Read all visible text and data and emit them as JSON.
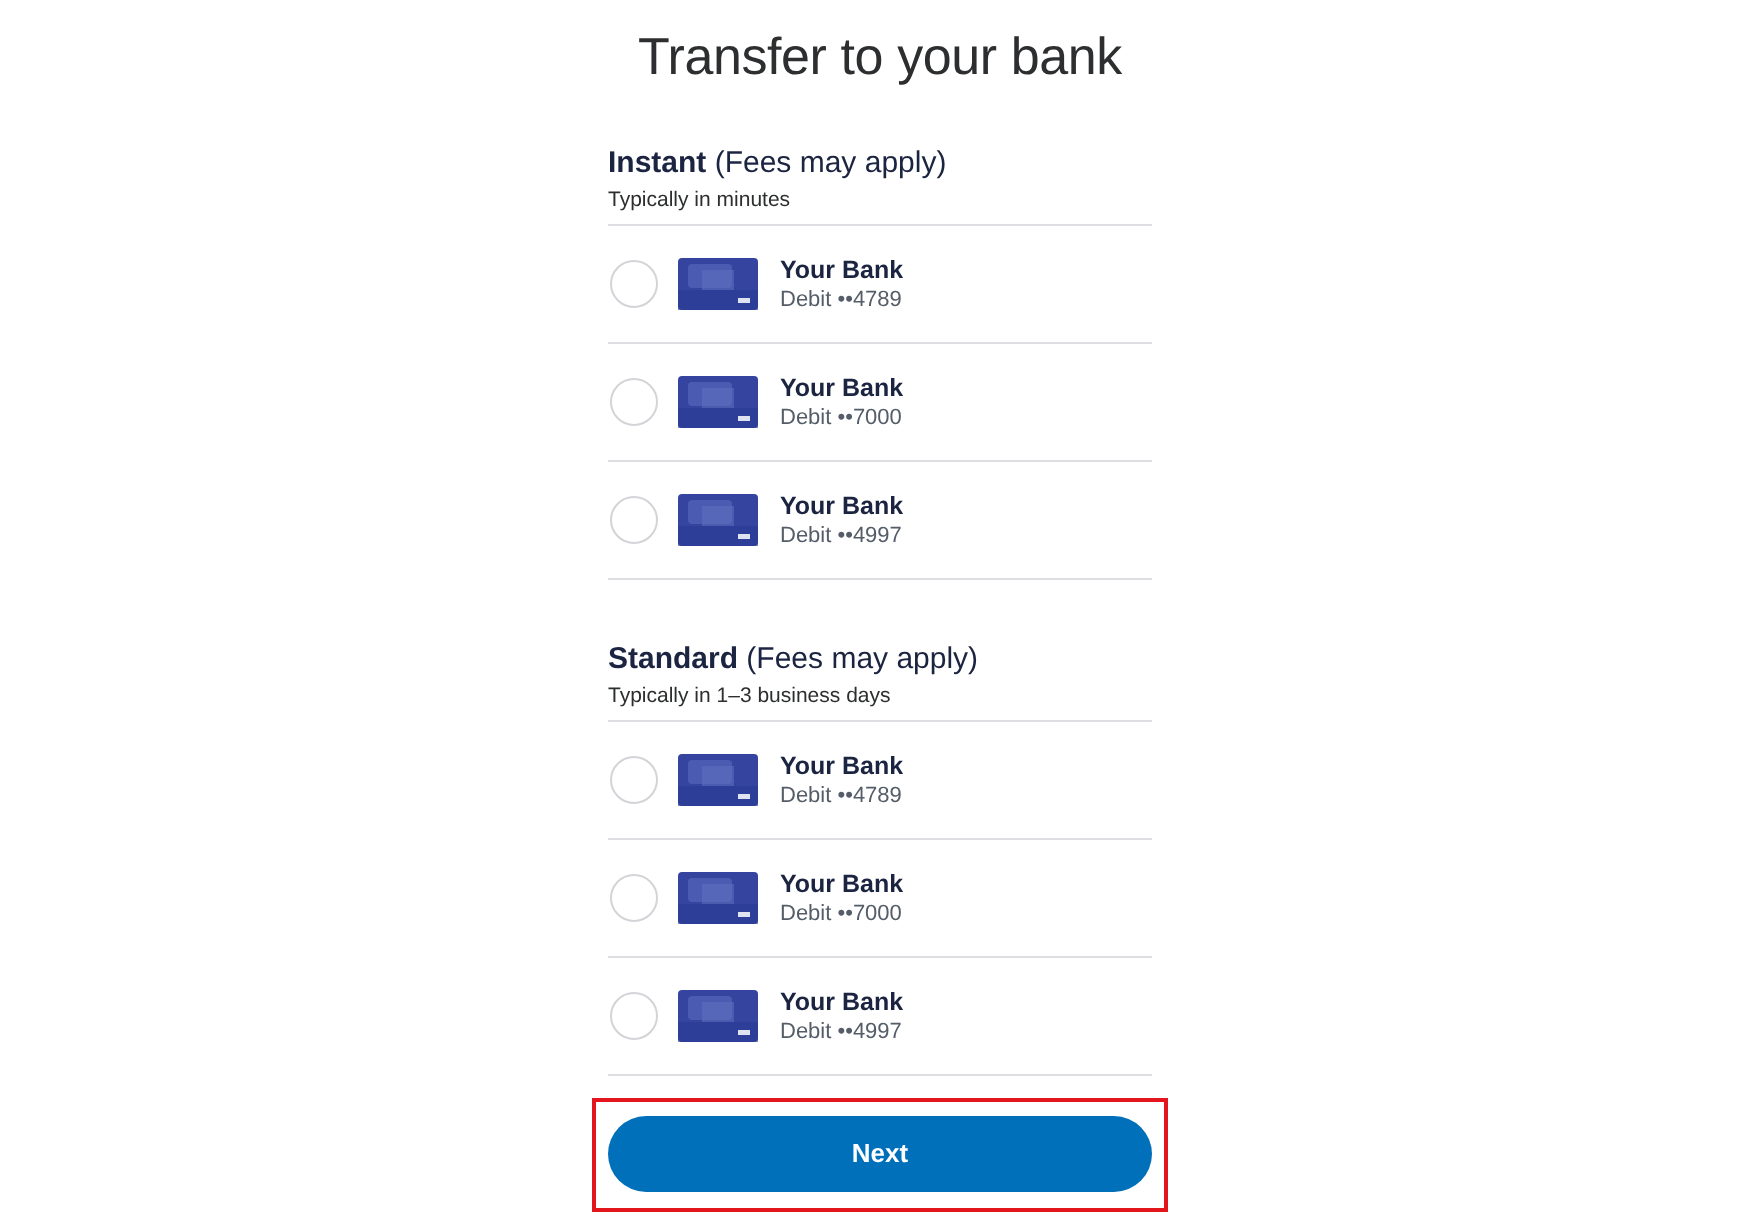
{
  "page": {
    "title": "Transfer to your bank"
  },
  "sections": [
    {
      "heading": "**Instant** (Fees may apply)",
      "subtitle": "Typically in minutes",
      "accounts": [
        {
          "name": "Your Bank",
          "detail": "Debit ••4789",
          "selected": false
        },
        {
          "name": "Your Bank",
          "detail": "Debit ••7000",
          "selected": false
        },
        {
          "name": "Your Bank",
          "detail": "Debit ••4997",
          "selected": false
        }
      ]
    },
    {
      "heading": "**Standard** (Fees may apply)",
      "subtitle": "Typically in 1–3 business days",
      "accounts": [
        {
          "name": "Your Bank",
          "detail": "Debit ••4789",
          "selected": false
        },
        {
          "name": "Your Bank",
          "detail": "Debit ••7000",
          "selected": false
        },
        {
          "name": "Your Bank",
          "detail": "Debit ••4997",
          "selected": false
        }
      ]
    }
  ],
  "next_button": {
    "label": "Next",
    "highlighted": true
  }
}
